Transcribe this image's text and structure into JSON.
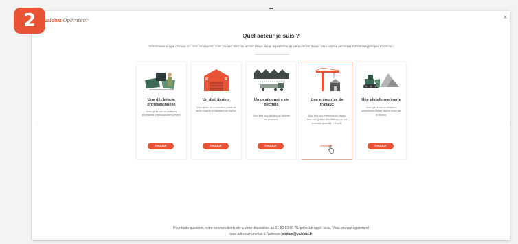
{
  "step_number": "2",
  "logo": {
    "part1": "valobat",
    "part2": "Opérateur"
  },
  "close_label": "×",
  "title": "Quel acteur je suis ?",
  "subtitle": "Sélectionner le type d'acteur qui vous correspond. Vous pourrez dans un second temps élargir le périmètre de votre compte depuis votre espace personnel à d'autres typologies d'acteurs !",
  "cards": [
    {
      "title": "Une déchèterie professionnelle",
      "description": "Vous gérez une ou plusieurs déchèteries professionnelles privées.",
      "button": "CHOISIR",
      "icon": "skip-containers-icon"
    },
    {
      "title": "Un distributeur",
      "description": "Vous gérez un ou plusieurs points de vente équipés d'installation de reprise.",
      "button": "CHOISIR",
      "icon": "warehouse-icon"
    },
    {
      "title": "Un gestionnaire de déchets",
      "description": "Vous êtes un collecteur de déchets sur chantiers.",
      "button": "CHOISIR",
      "icon": "waste-truck-icon"
    },
    {
      "title": "Une entreprise de travaux",
      "description": "Vous êtes une entreprise de travaux avec une gestion des déchets sur vos chantiers (quantité > 50 m3).",
      "button": "CHOISIR",
      "icon": "crane-icon",
      "selected": true
    },
    {
      "title": "Une plateforme inerte",
      "description": "Vous gérez une ou plusieurs plateformes inertes (apport direct par le déchet).",
      "button": "CHOISIR",
      "icon": "bulldozer-icon"
    }
  ],
  "footer": {
    "line1": "Pour toute question, notre service clients est à votre disposition au 01 80 83 60 70, prix d'un appel local. Vous pouvez également",
    "line2_pre": "nous adresser un mail à l'adresse",
    "email": "contact@valobat.fr",
    "line2_post": "."
  },
  "colors": {
    "accent": "#ea5436",
    "selected_border": "#f2a48f"
  }
}
